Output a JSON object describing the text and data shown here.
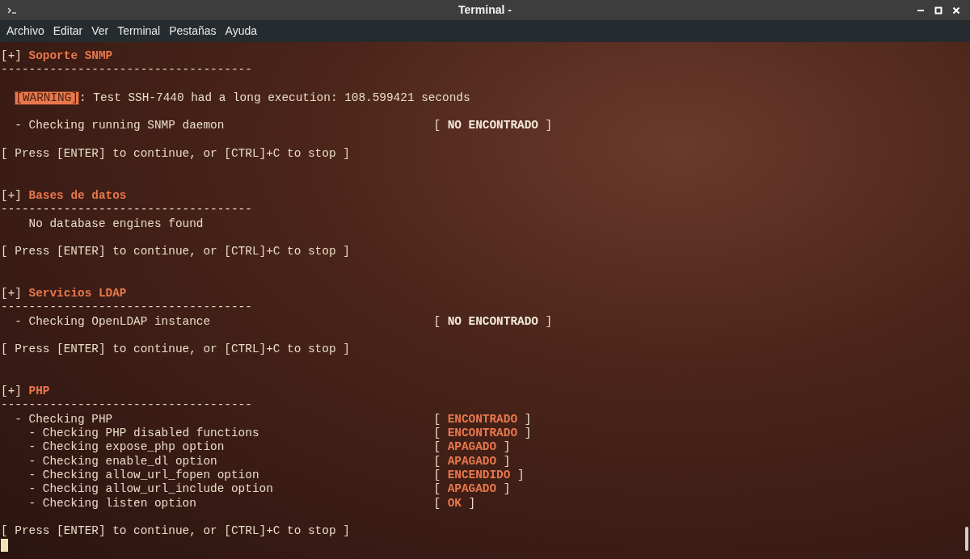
{
  "window": {
    "title": "Terminal -"
  },
  "menu": [
    "Archivo",
    "Editar",
    "Ver",
    "Terminal",
    "Pestañas",
    "Ayuda"
  ],
  "lines": [
    {
      "kind": "section",
      "bracket": "[+]",
      "title": "Soporte SNMP"
    },
    {
      "kind": "rule",
      "text": "------------------------------------"
    },
    {
      "kind": "blank"
    },
    {
      "kind": "warning",
      "tag": "[WARNING]",
      "text": ": Test SSH-7440 had a long execution: 108.599421 seconds"
    },
    {
      "kind": "blank"
    },
    {
      "kind": "check",
      "label": "- Checking running SNMP daemon",
      "open": "[",
      "status": "NO ENCONTRADO",
      "close": "]",
      "color": "#f2e8d8"
    },
    {
      "kind": "blank"
    },
    {
      "kind": "prompt",
      "text": "[ Press [ENTER] to continue, or [CTRL]+C to stop ]"
    },
    {
      "kind": "blank"
    },
    {
      "kind": "blank"
    },
    {
      "kind": "section",
      "bracket": "[+]",
      "title": "Bases de datos"
    },
    {
      "kind": "rule",
      "text": "------------------------------------"
    },
    {
      "kind": "note",
      "text": "No database engines found"
    },
    {
      "kind": "blank"
    },
    {
      "kind": "prompt",
      "text": "[ Press [ENTER] to continue, or [CTRL]+C to stop ]"
    },
    {
      "kind": "blank"
    },
    {
      "kind": "blank"
    },
    {
      "kind": "section",
      "bracket": "[+]",
      "title": "Servicios LDAP"
    },
    {
      "kind": "rule",
      "text": "------------------------------------"
    },
    {
      "kind": "check",
      "label": "- Checking OpenLDAP instance",
      "open": "[",
      "status": "NO ENCONTRADO",
      "close": "]",
      "color": "#f2e8d8"
    },
    {
      "kind": "blank"
    },
    {
      "kind": "prompt",
      "text": "[ Press [ENTER] to continue, or [CTRL]+C to stop ]"
    },
    {
      "kind": "blank"
    },
    {
      "kind": "blank"
    },
    {
      "kind": "section",
      "bracket": "[+]",
      "title": "PHP"
    },
    {
      "kind": "rule",
      "text": "------------------------------------"
    },
    {
      "kind": "check",
      "label": "- Checking PHP",
      "open": "[",
      "status": "ENCONTRADO",
      "close": "]",
      "color": "#e8784c",
      "children": [
        {
          "label": "- Checking PHP disabled functions",
          "open": "[",
          "status": "ENCONTRADO",
          "close": "]",
          "color": "#e8784c"
        },
        {
          "label": "- Checking expose_php option",
          "open": "[",
          "status": "APAGADO",
          "close": "]",
          "color": "#e8784c"
        },
        {
          "label": "- Checking enable_dl option",
          "open": "[",
          "status": "APAGADO",
          "close": "]",
          "color": "#e8784c"
        },
        {
          "label": "- Checking allow_url_fopen option",
          "open": "[",
          "status": "ENCENDIDO",
          "close": "]",
          "color": "#e8784c"
        },
        {
          "label": "- Checking allow_url_include option",
          "open": "[",
          "status": "APAGADO",
          "close": "]",
          "color": "#e8784c"
        },
        {
          "label": "- Checking listen option",
          "open": "[",
          "status": "OK",
          "close": "]",
          "color": "#e8784c"
        }
      ]
    },
    {
      "kind": "blank"
    },
    {
      "kind": "prompt",
      "text": "[ Press [ENTER] to continue, or [CTRL]+C to stop ]"
    },
    {
      "kind": "cursor"
    }
  ]
}
